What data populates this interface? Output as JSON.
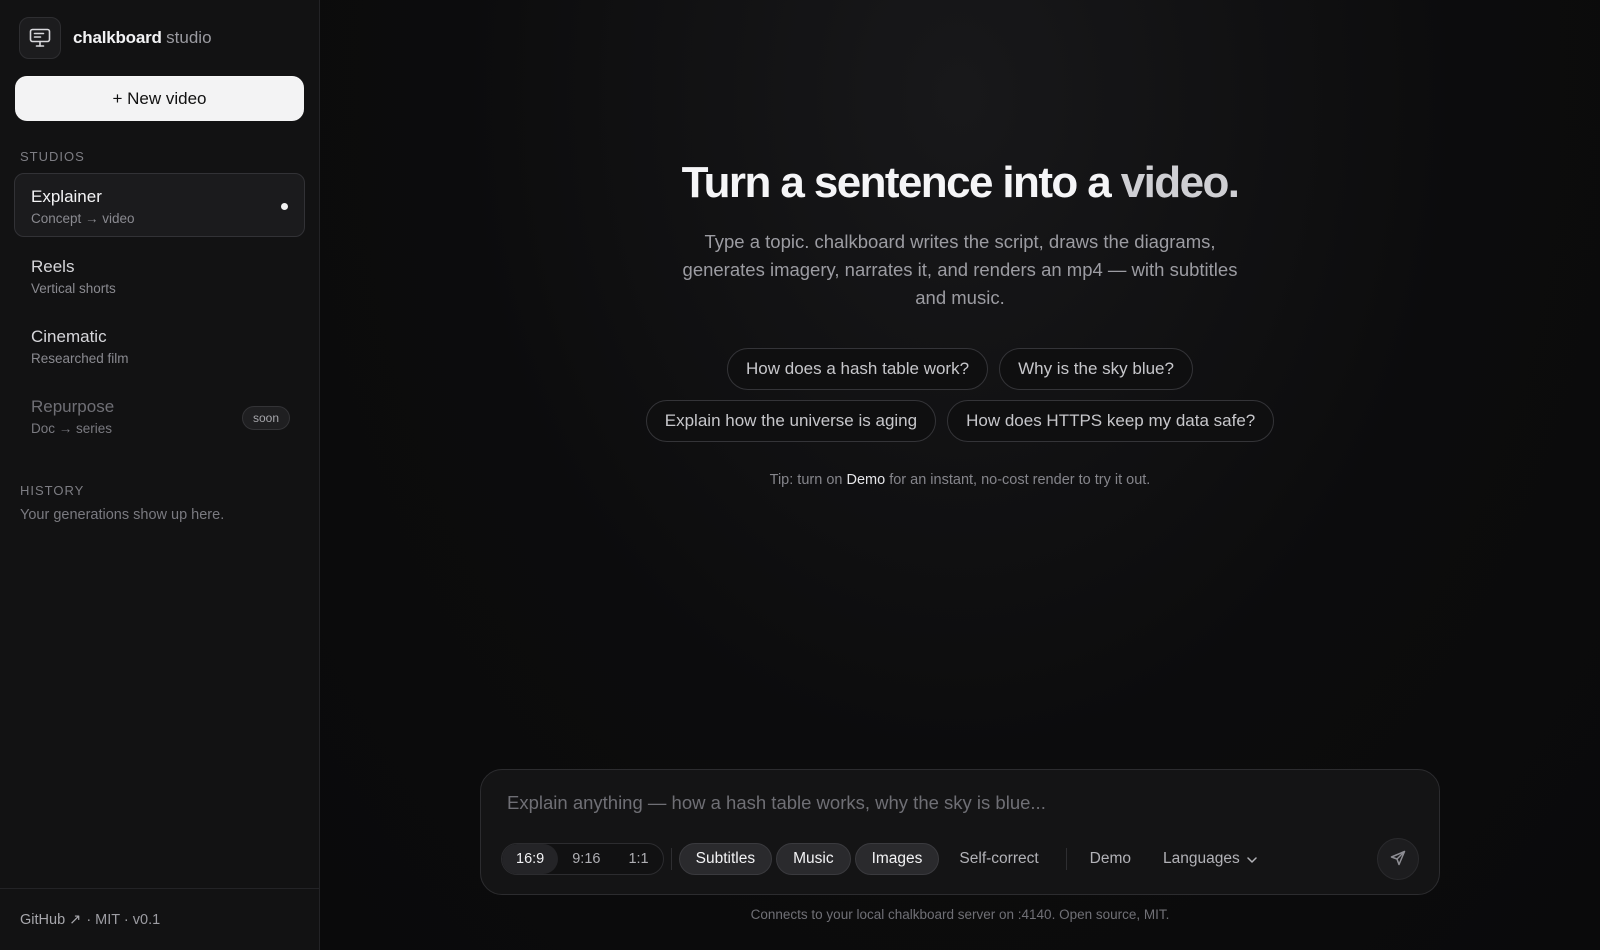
{
  "brand": {
    "name": "chalkboard",
    "suffix": "studio",
    "icon": "presentation-screen-icon"
  },
  "sidebar": {
    "new_button": "+ New video",
    "studios_label": "STUDIOS",
    "studios": [
      {
        "title": "Explainer",
        "desc": "Concept → video",
        "active": true
      },
      {
        "title": "Reels",
        "desc": "Vertical shorts"
      },
      {
        "title": "Cinematic",
        "desc": "Researched film"
      },
      {
        "title": "Repurpose",
        "desc": "Doc → series",
        "badge": "soon",
        "disabled": true
      }
    ],
    "history_label": "HISTORY",
    "history_empty": "Your generations show up here.",
    "footer": {
      "github": "GitHub ↗",
      "meta": "· MIT · v0.1"
    }
  },
  "hero": {
    "title_main": "Turn a sentence into a",
    "title_accent": "video.",
    "subtitle": "Type a topic. chalkboard writes the script, draws the diagrams, generates imagery, narrates it, and renders an mp4 — with subtitles and music.",
    "chips": [
      "How does a hash table work?",
      "Why is the sky blue?",
      "Explain how the universe is aging",
      "How does HTTPS keep my data safe?"
    ],
    "tip_prefix": "Tip: turn on",
    "tip_highlight": "Demo",
    "tip_suffix": "for an instant, no-cost render to try it out."
  },
  "composer": {
    "placeholder": "Explain anything — how a hash table works, why the sky is blue...",
    "value": "",
    "aspect_ratios": [
      "16:9",
      "9:16",
      "1:1"
    ],
    "selected_aspect": "16:9",
    "toggles": [
      {
        "label": "Subtitles",
        "on": true
      },
      {
        "label": "Music",
        "on": true
      },
      {
        "label": "Images",
        "on": true
      },
      {
        "label": "Self-correct",
        "on": false
      }
    ],
    "demo_label": "Demo",
    "languages_label": "Languages",
    "send_icon": "send-arrow-icon"
  },
  "footnote": "Connects to your local chalkboard server on :4140. Open source, MIT."
}
